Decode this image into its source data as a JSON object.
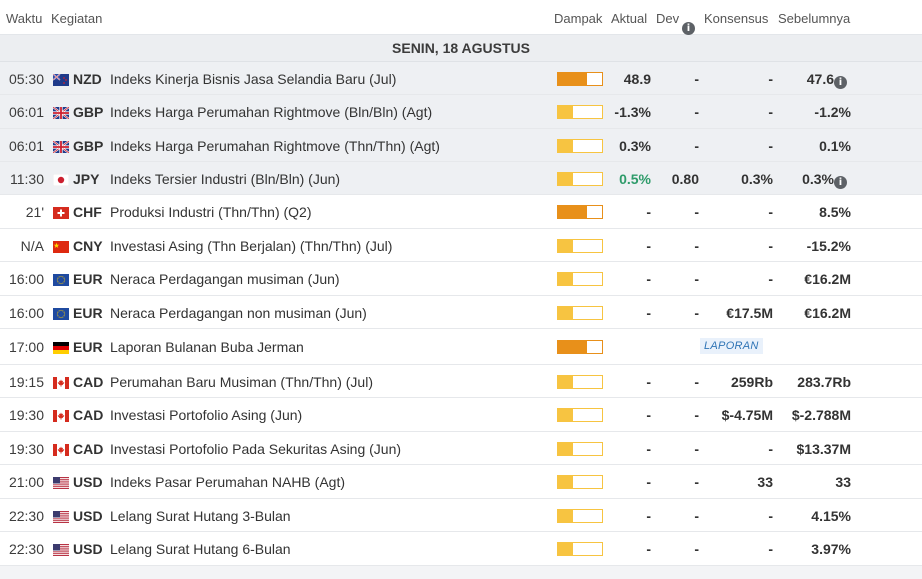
{
  "header": {
    "waktu": "Waktu",
    "kegiatan": "Kegiatan",
    "dampak": "Dampak",
    "aktual": "Aktual",
    "dev": "Dev",
    "konsensus": "Konsensus",
    "sebelumnya": "Sebelumnya"
  },
  "date_label": "SENIN, 18 AGUSTUS",
  "colors": {
    "impact_high": "#e8901a",
    "impact_low": "#f7c441",
    "positive": "#2e9b6a"
  },
  "events": [
    {
      "time": "05:30",
      "flag": "nz-flag-icon",
      "currency": "NZD",
      "name": "Indeks Kinerja Bisnis Jasa Selandia Baru (Jul)",
      "impact": 0.66,
      "actual": "48.9",
      "dev": "-",
      "consensus": "-",
      "previous": "47.6",
      "past": true
    },
    {
      "time": "06:01",
      "flag": "gb-flag-icon",
      "currency": "GBP",
      "name": "Indeks Harga Perumahan Rightmove (Bln/Bln) (Agt)",
      "impact": 0.33,
      "actual": "-1.3%",
      "dev": "-",
      "consensus": "-",
      "previous": "-1.2%",
      "past": true
    },
    {
      "time": "06:01",
      "flag": "gb-flag-icon",
      "currency": "GBP",
      "name": "Indeks Harga Perumahan Rightmove (Thn/Thn) (Agt)",
      "impact": 0.33,
      "actual": "0.3%",
      "dev": "-",
      "consensus": "-",
      "previous": "0.1%",
      "past": true
    },
    {
      "time": "11:30",
      "flag": "jp-flag-icon",
      "currency": "JPY",
      "name": "Indeks Tersier Industri (Bln/Bln) (Jun)",
      "impact": 0.33,
      "actual": "0.5%",
      "dev": "0.80",
      "consensus": "0.3%",
      "previous": "0.3%",
      "past": true
    },
    {
      "time": "21'",
      "flag": "ch-flag-icon",
      "currency": "CHF",
      "name": "Produksi Industri (Thn/Thn) (Q2)",
      "impact": 0.66,
      "actual": "-",
      "dev": "-",
      "consensus": "-",
      "previous": "8.5%",
      "past": false
    },
    {
      "time": "N/A",
      "flag": "cn-flag-icon",
      "currency": "CNY",
      "name": "Investasi Asing (Thn Berjalan) (Thn/Thn) (Jul)",
      "impact": 0.33,
      "actual": "-",
      "dev": "-",
      "consensus": "-",
      "previous": "-15.2%",
      "past": false
    },
    {
      "time": "16:00",
      "flag": "eu-flag-icon",
      "currency": "EUR",
      "name": "Neraca Perdagangan musiman (Jun)",
      "impact": 0.33,
      "actual": "-",
      "dev": "-",
      "consensus": "-",
      "previous": "€16.2M",
      "past": false
    },
    {
      "time": "16:00",
      "flag": "eu-flag-icon",
      "currency": "EUR",
      "name": "Neraca Perdagangan non musiman (Jun)",
      "impact": 0.33,
      "actual": "-",
      "dev": "-",
      "consensus": "€17.5M",
      "previous": "€16.2M",
      "past": false
    },
    {
      "time": "17:00",
      "flag": "de-flag-icon",
      "currency": "EUR",
      "name": "Laporan Bulanan Buba Jerman",
      "impact": 0.66,
      "report": "LAPORAN",
      "past": false
    },
    {
      "time": "19:15",
      "flag": "ca-flag-icon",
      "currency": "CAD",
      "name": "Perumahan Baru Musiman (Thn/Thn) (Jul)",
      "impact": 0.33,
      "actual": "-",
      "dev": "-",
      "consensus": "259Rb",
      "previous": "283.7Rb",
      "past": false
    },
    {
      "time": "19:30",
      "flag": "ca-flag-icon",
      "currency": "CAD",
      "name": "Investasi Portofolio Asing (Jun)",
      "impact": 0.33,
      "actual": "-",
      "dev": "-",
      "consensus": "$-4.75M",
      "previous": "$-2.788M",
      "past": false
    },
    {
      "time": "19:30",
      "flag": "ca-flag-icon",
      "currency": "CAD",
      "name": "Investasi Portofolio Pada Sekuritas Asing (Jun)",
      "impact": 0.33,
      "actual": "-",
      "dev": "-",
      "consensus": "-",
      "previous": "$13.37M",
      "past": false
    },
    {
      "time": "21:00",
      "flag": "us-flag-icon",
      "currency": "USD",
      "name": "Indeks Pasar Perumahan NAHB (Agt)",
      "impact": 0.33,
      "actual": "-",
      "dev": "-",
      "consensus": "33",
      "previous": "33",
      "past": false
    },
    {
      "time": "22:30",
      "flag": "us-flag-icon",
      "currency": "USD",
      "name": "Lelang Surat Hutang 3-Bulan",
      "impact": 0.33,
      "actual": "-",
      "dev": "-",
      "consensus": "-",
      "previous": "4.15%",
      "past": false
    },
    {
      "time": "22:30",
      "flag": "us-flag-icon",
      "currency": "USD",
      "name": "Lelang Surat Hutang 6-Bulan",
      "impact": 0.33,
      "actual": "-",
      "dev": "-",
      "consensus": "-",
      "previous": "3.97%",
      "past": false
    }
  ]
}
